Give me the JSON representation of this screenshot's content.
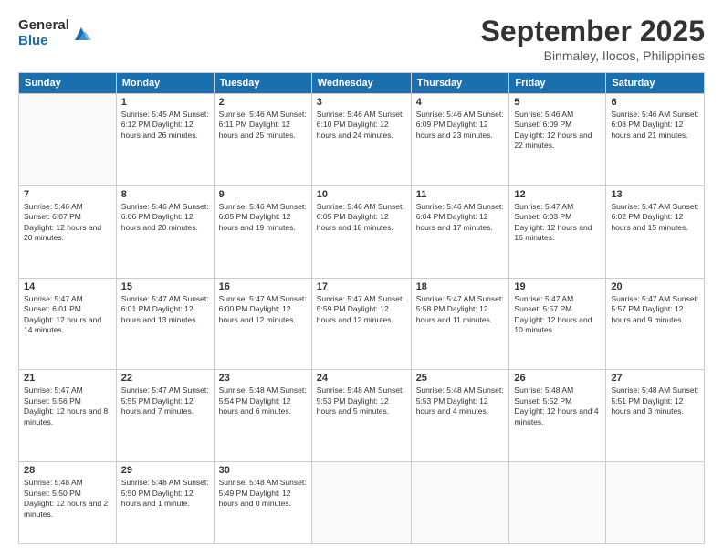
{
  "logo": {
    "general": "General",
    "blue": "Blue"
  },
  "header": {
    "month": "September 2025",
    "location": "Binmaley, Ilocos, Philippines"
  },
  "weekdays": [
    "Sunday",
    "Monday",
    "Tuesday",
    "Wednesday",
    "Thursday",
    "Friday",
    "Saturday"
  ],
  "weeks": [
    [
      {
        "day": "",
        "info": ""
      },
      {
        "day": "1",
        "info": "Sunrise: 5:45 AM\nSunset: 6:12 PM\nDaylight: 12 hours\nand 26 minutes."
      },
      {
        "day": "2",
        "info": "Sunrise: 5:46 AM\nSunset: 6:11 PM\nDaylight: 12 hours\nand 25 minutes."
      },
      {
        "day": "3",
        "info": "Sunrise: 5:46 AM\nSunset: 6:10 PM\nDaylight: 12 hours\nand 24 minutes."
      },
      {
        "day": "4",
        "info": "Sunrise: 5:46 AM\nSunset: 6:09 PM\nDaylight: 12 hours\nand 23 minutes."
      },
      {
        "day": "5",
        "info": "Sunrise: 5:46 AM\nSunset: 6:09 PM\nDaylight: 12 hours\nand 22 minutes."
      },
      {
        "day": "6",
        "info": "Sunrise: 5:46 AM\nSunset: 6:08 PM\nDaylight: 12 hours\nand 21 minutes."
      }
    ],
    [
      {
        "day": "7",
        "info": "Sunrise: 5:46 AM\nSunset: 6:07 PM\nDaylight: 12 hours\nand 20 minutes."
      },
      {
        "day": "8",
        "info": "Sunrise: 5:46 AM\nSunset: 6:06 PM\nDaylight: 12 hours\nand 20 minutes."
      },
      {
        "day": "9",
        "info": "Sunrise: 5:46 AM\nSunset: 6:05 PM\nDaylight: 12 hours\nand 19 minutes."
      },
      {
        "day": "10",
        "info": "Sunrise: 5:46 AM\nSunset: 6:05 PM\nDaylight: 12 hours\nand 18 minutes."
      },
      {
        "day": "11",
        "info": "Sunrise: 5:46 AM\nSunset: 6:04 PM\nDaylight: 12 hours\nand 17 minutes."
      },
      {
        "day": "12",
        "info": "Sunrise: 5:47 AM\nSunset: 6:03 PM\nDaylight: 12 hours\nand 16 minutes."
      },
      {
        "day": "13",
        "info": "Sunrise: 5:47 AM\nSunset: 6:02 PM\nDaylight: 12 hours\nand 15 minutes."
      }
    ],
    [
      {
        "day": "14",
        "info": "Sunrise: 5:47 AM\nSunset: 6:01 PM\nDaylight: 12 hours\nand 14 minutes."
      },
      {
        "day": "15",
        "info": "Sunrise: 5:47 AM\nSunset: 6:01 PM\nDaylight: 12 hours\nand 13 minutes."
      },
      {
        "day": "16",
        "info": "Sunrise: 5:47 AM\nSunset: 6:00 PM\nDaylight: 12 hours\nand 12 minutes."
      },
      {
        "day": "17",
        "info": "Sunrise: 5:47 AM\nSunset: 5:59 PM\nDaylight: 12 hours\nand 12 minutes."
      },
      {
        "day": "18",
        "info": "Sunrise: 5:47 AM\nSunset: 5:58 PM\nDaylight: 12 hours\nand 11 minutes."
      },
      {
        "day": "19",
        "info": "Sunrise: 5:47 AM\nSunset: 5:57 PM\nDaylight: 12 hours\nand 10 minutes."
      },
      {
        "day": "20",
        "info": "Sunrise: 5:47 AM\nSunset: 5:57 PM\nDaylight: 12 hours\nand 9 minutes."
      }
    ],
    [
      {
        "day": "21",
        "info": "Sunrise: 5:47 AM\nSunset: 5:56 PM\nDaylight: 12 hours\nand 8 minutes."
      },
      {
        "day": "22",
        "info": "Sunrise: 5:47 AM\nSunset: 5:55 PM\nDaylight: 12 hours\nand 7 minutes."
      },
      {
        "day": "23",
        "info": "Sunrise: 5:48 AM\nSunset: 5:54 PM\nDaylight: 12 hours\nand 6 minutes."
      },
      {
        "day": "24",
        "info": "Sunrise: 5:48 AM\nSunset: 5:53 PM\nDaylight: 12 hours\nand 5 minutes."
      },
      {
        "day": "25",
        "info": "Sunrise: 5:48 AM\nSunset: 5:53 PM\nDaylight: 12 hours\nand 4 minutes."
      },
      {
        "day": "26",
        "info": "Sunrise: 5:48 AM\nSunset: 5:52 PM\nDaylight: 12 hours\nand 4 minutes."
      },
      {
        "day": "27",
        "info": "Sunrise: 5:48 AM\nSunset: 5:51 PM\nDaylight: 12 hours\nand 3 minutes."
      }
    ],
    [
      {
        "day": "28",
        "info": "Sunrise: 5:48 AM\nSunset: 5:50 PM\nDaylight: 12 hours\nand 2 minutes."
      },
      {
        "day": "29",
        "info": "Sunrise: 5:48 AM\nSunset: 5:50 PM\nDaylight: 12 hours\nand 1 minute."
      },
      {
        "day": "30",
        "info": "Sunrise: 5:48 AM\nSunset: 5:49 PM\nDaylight: 12 hours\nand 0 minutes."
      },
      {
        "day": "",
        "info": ""
      },
      {
        "day": "",
        "info": ""
      },
      {
        "day": "",
        "info": ""
      },
      {
        "day": "",
        "info": ""
      }
    ]
  ]
}
